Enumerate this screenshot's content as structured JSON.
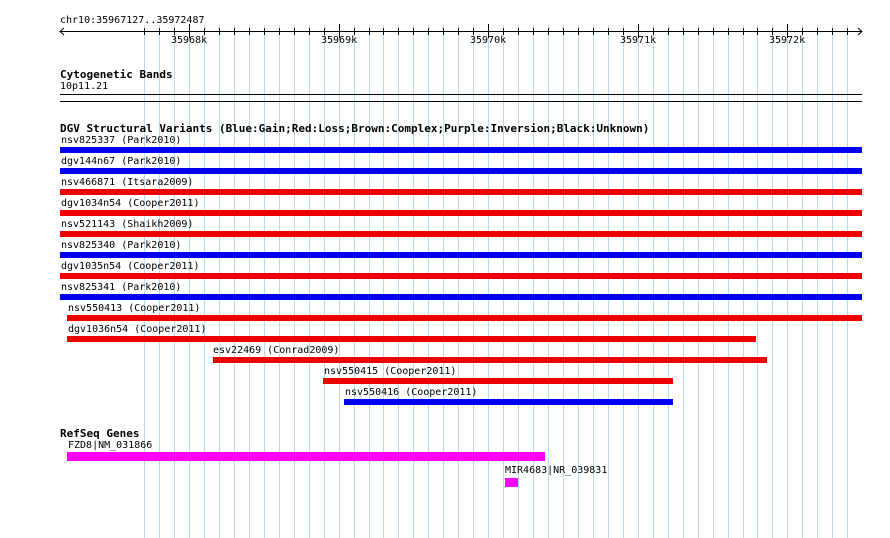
{
  "ruler": {
    "location": "chr10:35967127..35972487",
    "ticks": [
      "35968k",
      "35969k",
      "35970k",
      "35971k",
      "35972k"
    ]
  },
  "cytobands": {
    "title": "Cytogenetic Bands",
    "band": "10p11.21"
  },
  "dgv": {
    "title": "DGV Structural Variants (Blue:Gain;Red:Loss;Brown:Complex;Purple:Inversion;Black:Unknown)",
    "items": [
      {
        "label": "nsv825337 (Park2010)",
        "type": "gain",
        "color": "#0000ee"
      },
      {
        "label": "dgv144n67 (Park2010)",
        "type": "gain",
        "color": "#0000ee"
      },
      {
        "label": "nsv466871 (Itsara2009)",
        "type": "loss",
        "color": "#ee0000"
      },
      {
        "label": "dgv1034n54 (Cooper2011)",
        "type": "loss",
        "color": "#ee0000"
      },
      {
        "label": "nsv521143 (Shaikh2009)",
        "type": "loss",
        "color": "#ee0000"
      },
      {
        "label": "nsv825340 (Park2010)",
        "type": "gain",
        "color": "#0000ee"
      },
      {
        "label": "dgv1035n54 (Cooper2011)",
        "type": "loss",
        "color": "#ee0000"
      },
      {
        "label": "nsv825341 (Park2010)",
        "type": "gain",
        "color": "#0000ee"
      },
      {
        "label": "nsv550413 (Cooper2011)",
        "type": "loss",
        "color": "#ee0000"
      },
      {
        "label": "dgv1036n54 (Cooper2011)",
        "type": "loss",
        "color": "#ee0000"
      },
      {
        "label": "esv22469 (Conrad2009)",
        "type": "loss",
        "color": "#ee0000"
      },
      {
        "label": "nsv550415 (Cooper2011)",
        "type": "loss",
        "color": "#ee0000"
      },
      {
        "label": "nsv550416 (Cooper2011)",
        "type": "gain",
        "color": "#0000ee"
      }
    ]
  },
  "refseq": {
    "title": "RefSeq Genes",
    "color": "#ff00ff",
    "genes": [
      {
        "label": "FZD8|NM_031866"
      },
      {
        "label": "MIR4683|NR_039831"
      }
    ]
  }
}
